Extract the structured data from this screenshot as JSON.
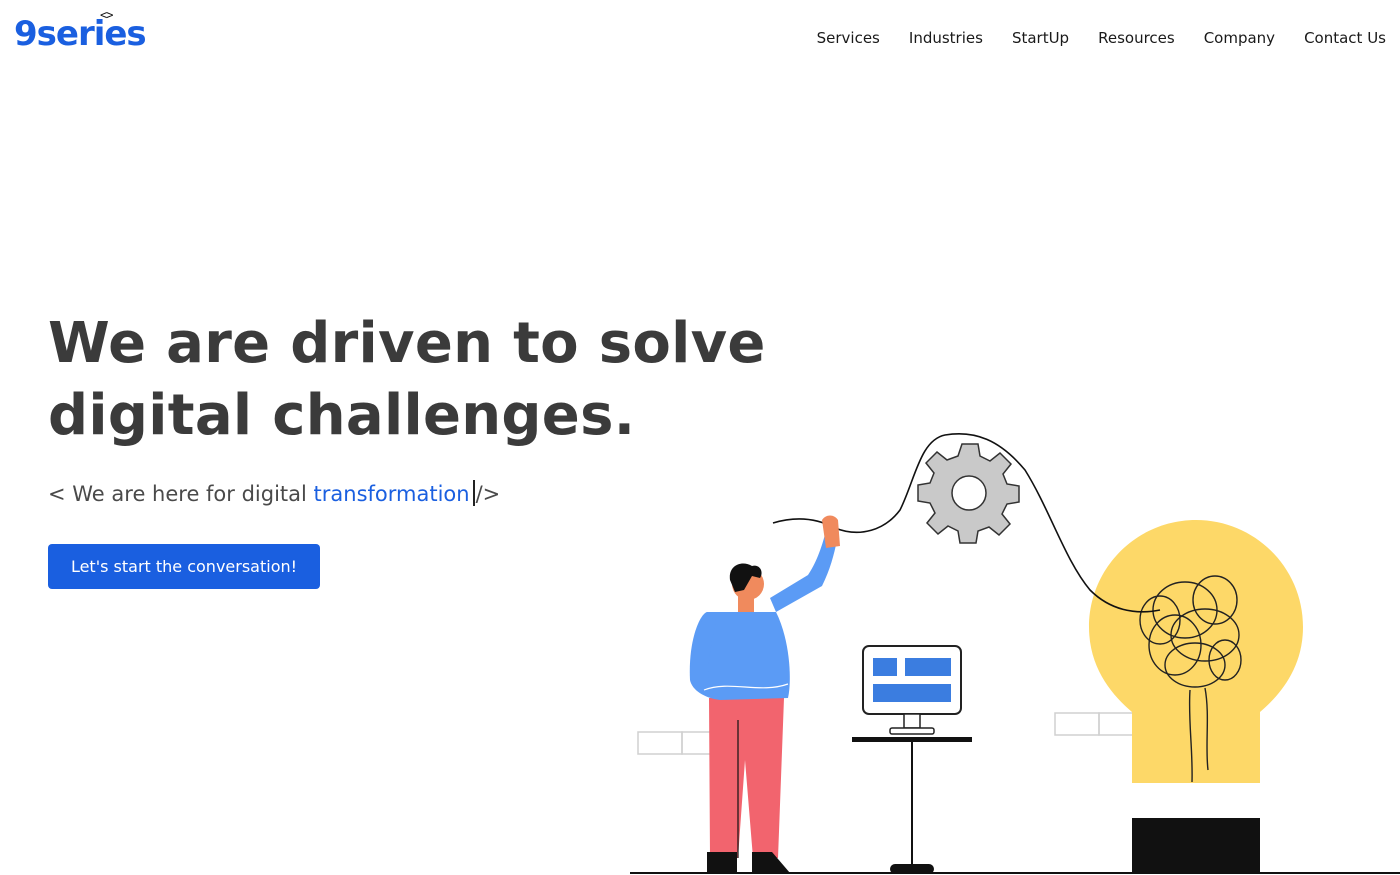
{
  "brand": {
    "logo_text": "9series",
    "logo_brackets": "<>",
    "color": "#1a5fe0"
  },
  "nav": {
    "items": [
      {
        "label": "Services"
      },
      {
        "label": "Industries"
      },
      {
        "label": "StartUp"
      },
      {
        "label": "Resources"
      },
      {
        "label": "Company"
      },
      {
        "label": "Contact Us"
      }
    ]
  },
  "hero": {
    "title_line1": "We are driven to solve",
    "title_line2": "digital challenges.",
    "sub_prefix": "< We are here for digital ",
    "sub_accent": "transformation",
    "sub_suffix": "/>",
    "cta_label": "Let's start the conversation!"
  },
  "colors": {
    "accent": "#1a5fe0",
    "title": "#3b3b3b",
    "shirt": "#5b9bf5",
    "pants": "#f2646e",
    "bulb": "#fdd868",
    "gear": "#c9c9c9"
  },
  "icons": [
    "gear-icon",
    "lightbulb-icon",
    "monitor-icon",
    "person-illustration"
  ]
}
